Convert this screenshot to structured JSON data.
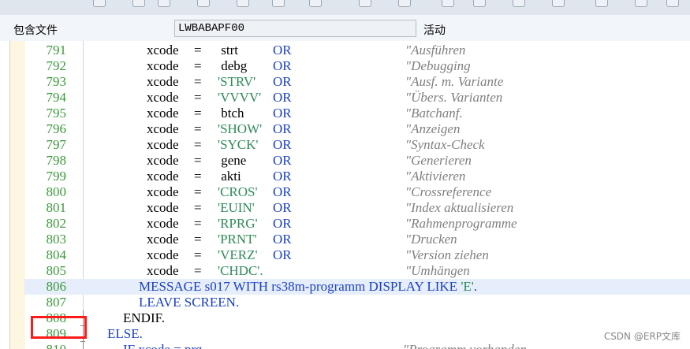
{
  "header": {
    "include_label": "包含文件",
    "include_value": "LWBABAPF00",
    "status": "活动"
  },
  "lines": [
    {
      "n": "791",
      "var": "xcode",
      "eq": "=",
      "val": " strt",
      "or": "OR",
      "comment": "\"Ausführen"
    },
    {
      "n": "792",
      "var": "xcode",
      "eq": "=",
      "val": " debg",
      "or": "OR",
      "comment": "\"Debugging"
    },
    {
      "n": "793",
      "var": "xcode",
      "eq": "=",
      "val": "'STRV'",
      "or": "OR",
      "comment": "\"Ausf. m. Variante"
    },
    {
      "n": "794",
      "var": "xcode",
      "eq": "=",
      "val": "'VVVV'",
      "or": "OR",
      "comment": "\"Übers. Varianten"
    },
    {
      "n": "795",
      "var": "xcode",
      "eq": "=",
      "val": " btch",
      "or": "OR",
      "comment": "\"Batchanf."
    },
    {
      "n": "796",
      "var": "xcode",
      "eq": "=",
      "val": "'SHOW'",
      "or": "OR",
      "comment": "\"Anzeigen"
    },
    {
      "n": "797",
      "var": "xcode",
      "eq": "=",
      "val": "'SYCK'",
      "or": "OR",
      "comment": "\"Syntax-Check"
    },
    {
      "n": "798",
      "var": "xcode",
      "eq": "=",
      "val": " gene",
      "or": "OR",
      "comment": "\"Generieren"
    },
    {
      "n": "799",
      "var": "xcode",
      "eq": "=",
      "val": " akti",
      "or": "OR",
      "comment": "\"Aktivieren"
    },
    {
      "n": "800",
      "var": "xcode",
      "eq": "=",
      "val": "'CROS'",
      "or": "OR",
      "comment": "\"Crossreference"
    },
    {
      "n": "801",
      "var": "xcode",
      "eq": "=",
      "val": "'EUIN'",
      "or": "OR",
      "comment": "\"Index aktualisieren"
    },
    {
      "n": "802",
      "var": "xcode",
      "eq": "=",
      "val": "'RPRG'",
      "or": "OR",
      "comment": "\"Rahmenprogramme"
    },
    {
      "n": "803",
      "var": "xcode",
      "eq": "=",
      "val": "'PRNT'",
      "or": "OR",
      "comment": "\"Drucken"
    },
    {
      "n": "804",
      "var": "xcode",
      "eq": "=",
      "val": "'VERZ'",
      "or": "OR",
      "comment": "\"Version ziehen"
    },
    {
      "n": "805",
      "var": "xcode",
      "eq": "=",
      "val": "'CHDC'.",
      "or": "",
      "comment": "\"Umhängen"
    }
  ],
  "line806": {
    "n": "806",
    "msg": "MESSAGE s017",
    "with": "WITH rs38m-programm",
    "disp": "DISPLAY LIKE",
    "e": "'E'",
    "dot": "."
  },
  "line807": {
    "n": "807",
    "text": "LEAVE SCREEN."
  },
  "line808": {
    "n": "808",
    "text": "ENDIF."
  },
  "line809": {
    "n": "809",
    "text": "ELSE."
  },
  "line810": {
    "n": "810",
    "code": "IF xcode = prg",
    "comment": "\"Programm vorhanden"
  },
  "watermark": "CSDN @ERP文库"
}
